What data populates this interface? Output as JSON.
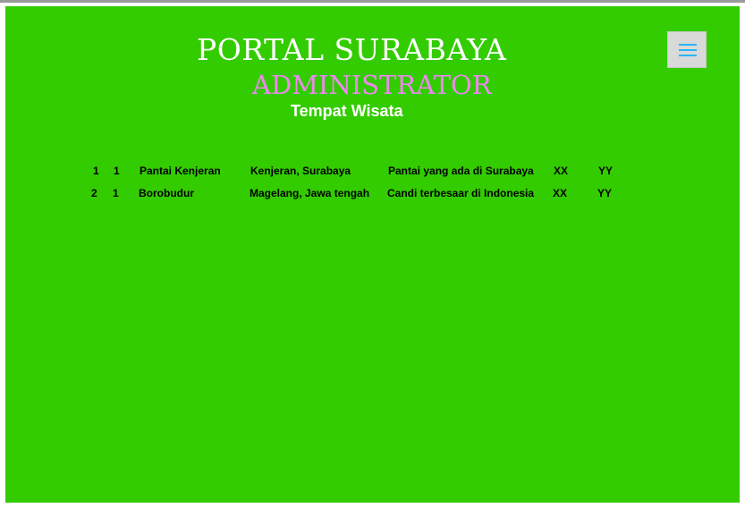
{
  "header": {
    "title": "PORTAL SURABAYA",
    "subtitle": "ADMINISTRATOR",
    "section": "Tempat Wisata"
  },
  "menu_button": {
    "icon": "hamburger-menu-icon"
  },
  "colors": {
    "panel_background": "#33cc00",
    "title": "#ffffff",
    "subtitle": "#ee88ee",
    "menu_bars": "#29b6f6",
    "menu_button_bg": "#d9d9d9"
  },
  "table": {
    "rows": [
      {
        "no": "1",
        "kategori": "1",
        "nama": "Pantai Kenjeran",
        "lokasi": "Kenjeran, Surabaya",
        "deskripsi": "Pantai yang ada di Surabaya",
        "x": "XX",
        "y": "YY"
      },
      {
        "no": "2",
        "kategori": "1",
        "nama": "Borobudur",
        "lokasi": "Magelang, Jawa tengah",
        "deskripsi": "Candi terbesaar di Indonesia",
        "x": "XX",
        "y": "YY"
      }
    ]
  }
}
